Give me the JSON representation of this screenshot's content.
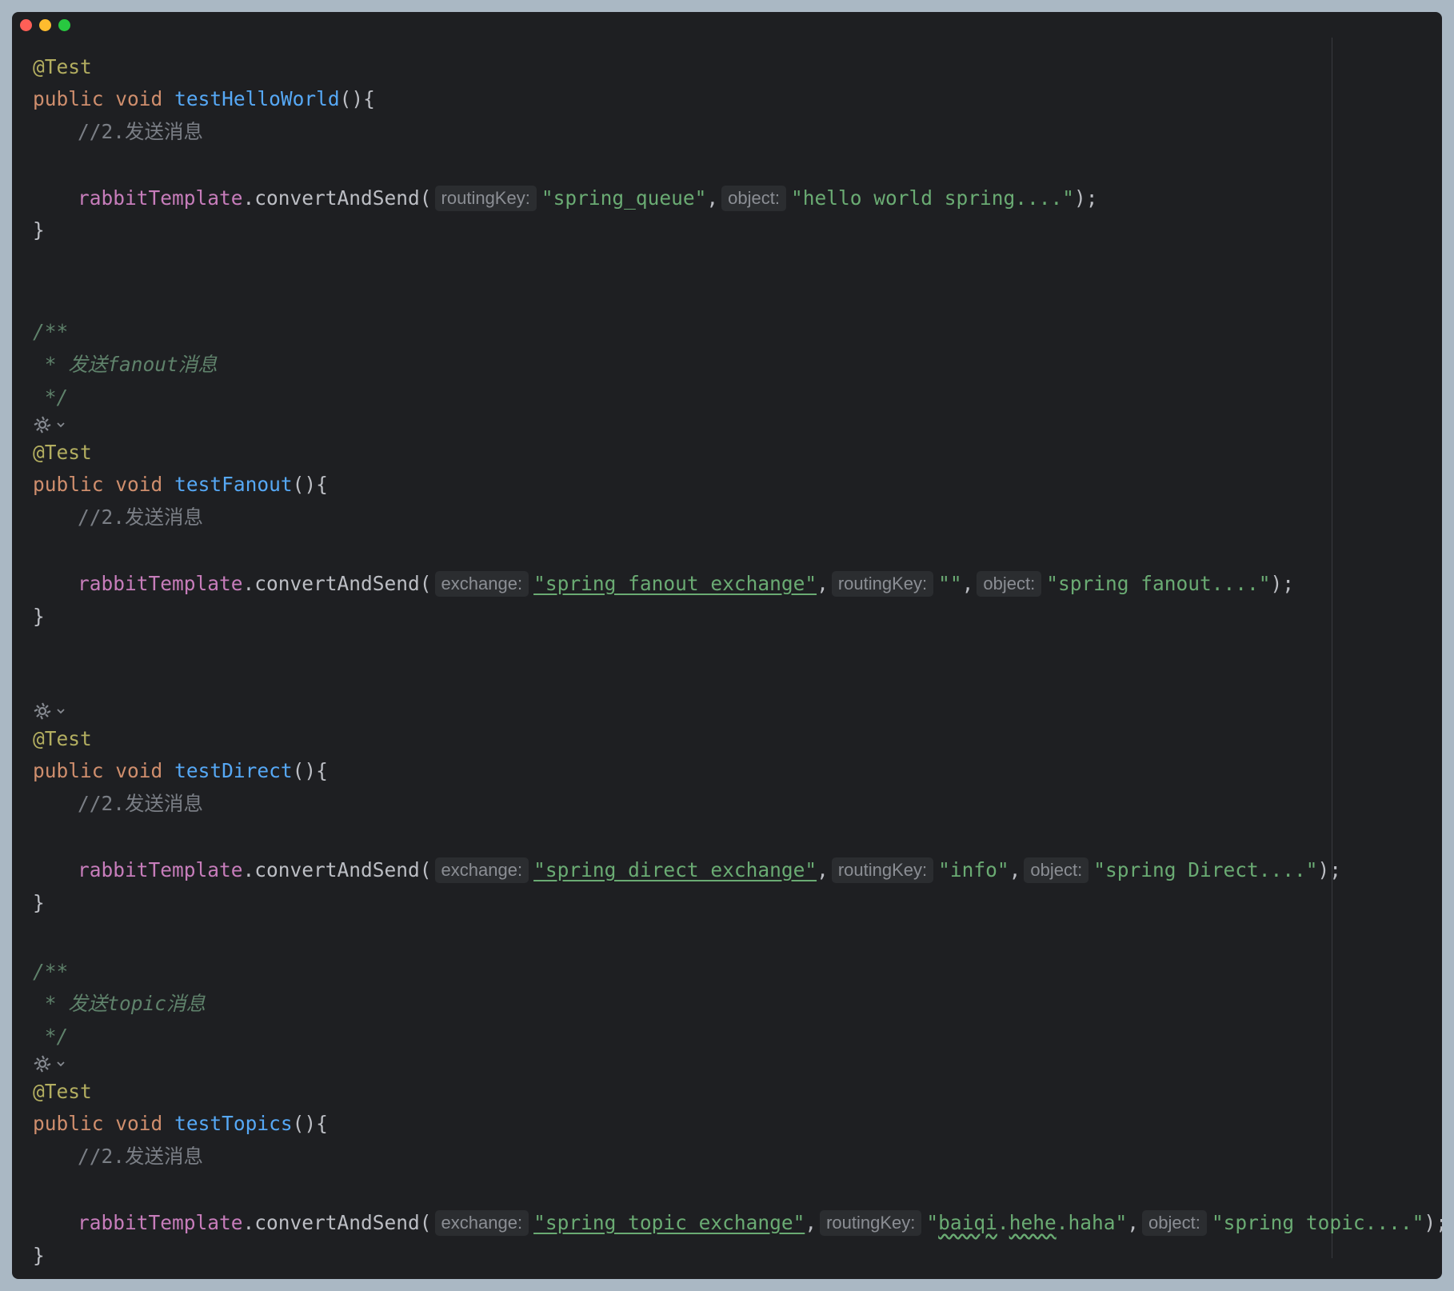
{
  "common": {
    "annotation": "@Test",
    "kw_public": "public",
    "kw_void": "void",
    "parens": "(){",
    "close_brace": "}",
    "comment_send": "//2.发送消息",
    "field": "rabbitTemplate",
    "call": ".convertAndSend(",
    "comma": ",",
    "end": ");",
    "doc_open": "/**",
    "doc_close": " */",
    "param_exchange": "exchange:",
    "param_routing": "routingKey:",
    "param_object": "object:"
  },
  "icons": {
    "gutter": "test-run-icon",
    "chevron": "chevron-down-icon"
  },
  "methods": [
    {
      "name": "testHelloWorld",
      "routing_key": "\"spring_queue\"",
      "object": "\"hello world spring....\""
    },
    {
      "doc": " * 发送fanout消息",
      "name": "testFanout",
      "exchange": "\"spring_fanout_exchange\"",
      "routing_key": "\"\"",
      "object": "\"spring fanout....\""
    },
    {
      "name": "testDirect",
      "exchange": "\"spring_direct_exchange\"",
      "routing_key": "\"info\"",
      "object": "\"spring Direct....\""
    },
    {
      "doc": " * 发送topic消息",
      "name": "testTopics",
      "exchange": "\"spring_topic_exchange\"",
      "routing_key_parts": [
        "\"",
        "baiqi",
        ".",
        "hehe",
        ".haha\""
      ],
      "object": "\"spring topic....\""
    }
  ],
  "colors": {
    "background": "#1e1f22",
    "keyword": "#cf8e6d",
    "annotation": "#b3ae60",
    "method": "#56a8f5",
    "field": "#c77dbb",
    "string": "#6aab73",
    "comment": "#7a7e85",
    "doc_comment": "#5f826b"
  }
}
